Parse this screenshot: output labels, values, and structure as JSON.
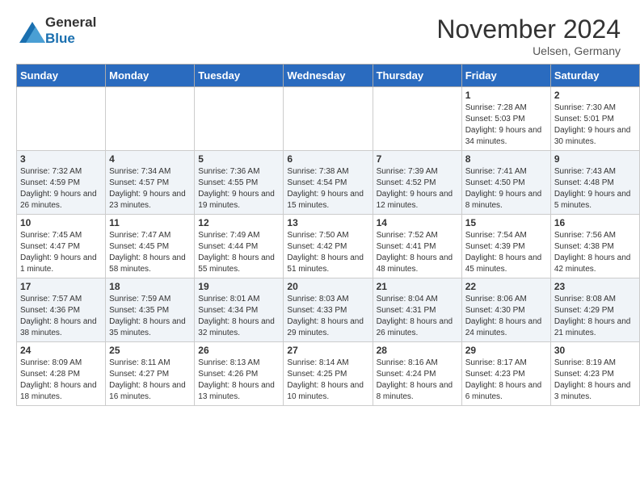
{
  "header": {
    "logo_general": "General",
    "logo_blue": "Blue",
    "title": "November 2024",
    "location": "Uelsen, Germany"
  },
  "days_of_week": [
    "Sunday",
    "Monday",
    "Tuesday",
    "Wednesday",
    "Thursday",
    "Friday",
    "Saturday"
  ],
  "weeks": [
    {
      "shaded": false,
      "days": [
        {
          "num": "",
          "sunrise": "",
          "sunset": "",
          "daylight": ""
        },
        {
          "num": "",
          "sunrise": "",
          "sunset": "",
          "daylight": ""
        },
        {
          "num": "",
          "sunrise": "",
          "sunset": "",
          "daylight": ""
        },
        {
          "num": "",
          "sunrise": "",
          "sunset": "",
          "daylight": ""
        },
        {
          "num": "",
          "sunrise": "",
          "sunset": "",
          "daylight": ""
        },
        {
          "num": "1",
          "sunrise": "Sunrise: 7:28 AM",
          "sunset": "Sunset: 5:03 PM",
          "daylight": "Daylight: 9 hours and 34 minutes."
        },
        {
          "num": "2",
          "sunrise": "Sunrise: 7:30 AM",
          "sunset": "Sunset: 5:01 PM",
          "daylight": "Daylight: 9 hours and 30 minutes."
        }
      ]
    },
    {
      "shaded": true,
      "days": [
        {
          "num": "3",
          "sunrise": "Sunrise: 7:32 AM",
          "sunset": "Sunset: 4:59 PM",
          "daylight": "Daylight: 9 hours and 26 minutes."
        },
        {
          "num": "4",
          "sunrise": "Sunrise: 7:34 AM",
          "sunset": "Sunset: 4:57 PM",
          "daylight": "Daylight: 9 hours and 23 minutes."
        },
        {
          "num": "5",
          "sunrise": "Sunrise: 7:36 AM",
          "sunset": "Sunset: 4:55 PM",
          "daylight": "Daylight: 9 hours and 19 minutes."
        },
        {
          "num": "6",
          "sunrise": "Sunrise: 7:38 AM",
          "sunset": "Sunset: 4:54 PM",
          "daylight": "Daylight: 9 hours and 15 minutes."
        },
        {
          "num": "7",
          "sunrise": "Sunrise: 7:39 AM",
          "sunset": "Sunset: 4:52 PM",
          "daylight": "Daylight: 9 hours and 12 minutes."
        },
        {
          "num": "8",
          "sunrise": "Sunrise: 7:41 AM",
          "sunset": "Sunset: 4:50 PM",
          "daylight": "Daylight: 9 hours and 8 minutes."
        },
        {
          "num": "9",
          "sunrise": "Sunrise: 7:43 AM",
          "sunset": "Sunset: 4:48 PM",
          "daylight": "Daylight: 9 hours and 5 minutes."
        }
      ]
    },
    {
      "shaded": false,
      "days": [
        {
          "num": "10",
          "sunrise": "Sunrise: 7:45 AM",
          "sunset": "Sunset: 4:47 PM",
          "daylight": "Daylight: 9 hours and 1 minute."
        },
        {
          "num": "11",
          "sunrise": "Sunrise: 7:47 AM",
          "sunset": "Sunset: 4:45 PM",
          "daylight": "Daylight: 8 hours and 58 minutes."
        },
        {
          "num": "12",
          "sunrise": "Sunrise: 7:49 AM",
          "sunset": "Sunset: 4:44 PM",
          "daylight": "Daylight: 8 hours and 55 minutes."
        },
        {
          "num": "13",
          "sunrise": "Sunrise: 7:50 AM",
          "sunset": "Sunset: 4:42 PM",
          "daylight": "Daylight: 8 hours and 51 minutes."
        },
        {
          "num": "14",
          "sunrise": "Sunrise: 7:52 AM",
          "sunset": "Sunset: 4:41 PM",
          "daylight": "Daylight: 8 hours and 48 minutes."
        },
        {
          "num": "15",
          "sunrise": "Sunrise: 7:54 AM",
          "sunset": "Sunset: 4:39 PM",
          "daylight": "Daylight: 8 hours and 45 minutes."
        },
        {
          "num": "16",
          "sunrise": "Sunrise: 7:56 AM",
          "sunset": "Sunset: 4:38 PM",
          "daylight": "Daylight: 8 hours and 42 minutes."
        }
      ]
    },
    {
      "shaded": true,
      "days": [
        {
          "num": "17",
          "sunrise": "Sunrise: 7:57 AM",
          "sunset": "Sunset: 4:36 PM",
          "daylight": "Daylight: 8 hours and 38 minutes."
        },
        {
          "num": "18",
          "sunrise": "Sunrise: 7:59 AM",
          "sunset": "Sunset: 4:35 PM",
          "daylight": "Daylight: 8 hours and 35 minutes."
        },
        {
          "num": "19",
          "sunrise": "Sunrise: 8:01 AM",
          "sunset": "Sunset: 4:34 PM",
          "daylight": "Daylight: 8 hours and 32 minutes."
        },
        {
          "num": "20",
          "sunrise": "Sunrise: 8:03 AM",
          "sunset": "Sunset: 4:33 PM",
          "daylight": "Daylight: 8 hours and 29 minutes."
        },
        {
          "num": "21",
          "sunrise": "Sunrise: 8:04 AM",
          "sunset": "Sunset: 4:31 PM",
          "daylight": "Daylight: 8 hours and 26 minutes."
        },
        {
          "num": "22",
          "sunrise": "Sunrise: 8:06 AM",
          "sunset": "Sunset: 4:30 PM",
          "daylight": "Daylight: 8 hours and 24 minutes."
        },
        {
          "num": "23",
          "sunrise": "Sunrise: 8:08 AM",
          "sunset": "Sunset: 4:29 PM",
          "daylight": "Daylight: 8 hours and 21 minutes."
        }
      ]
    },
    {
      "shaded": false,
      "days": [
        {
          "num": "24",
          "sunrise": "Sunrise: 8:09 AM",
          "sunset": "Sunset: 4:28 PM",
          "daylight": "Daylight: 8 hours and 18 minutes."
        },
        {
          "num": "25",
          "sunrise": "Sunrise: 8:11 AM",
          "sunset": "Sunset: 4:27 PM",
          "daylight": "Daylight: 8 hours and 16 minutes."
        },
        {
          "num": "26",
          "sunrise": "Sunrise: 8:13 AM",
          "sunset": "Sunset: 4:26 PM",
          "daylight": "Daylight: 8 hours and 13 minutes."
        },
        {
          "num": "27",
          "sunrise": "Sunrise: 8:14 AM",
          "sunset": "Sunset: 4:25 PM",
          "daylight": "Daylight: 8 hours and 10 minutes."
        },
        {
          "num": "28",
          "sunrise": "Sunrise: 8:16 AM",
          "sunset": "Sunset: 4:24 PM",
          "daylight": "Daylight: 8 hours and 8 minutes."
        },
        {
          "num": "29",
          "sunrise": "Sunrise: 8:17 AM",
          "sunset": "Sunset: 4:23 PM",
          "daylight": "Daylight: 8 hours and 6 minutes."
        },
        {
          "num": "30",
          "sunrise": "Sunrise: 8:19 AM",
          "sunset": "Sunset: 4:23 PM",
          "daylight": "Daylight: 8 hours and 3 minutes."
        }
      ]
    }
  ]
}
